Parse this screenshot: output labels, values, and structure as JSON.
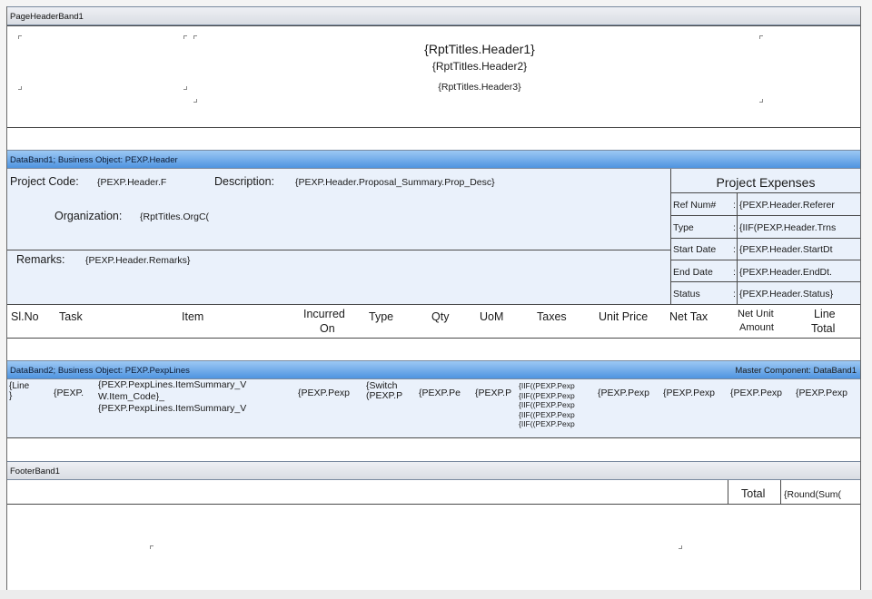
{
  "bands": {
    "page_header": "PageHeaderBand1",
    "data1": "DataBand1; Business Object: PEXP.Header",
    "data2": "DataBand2; Business Object: PEXP.PexpLines",
    "data2_master": "Master Component: DataBand1",
    "footer": "FooterBand1"
  },
  "header": {
    "title1": "{RptTitles.Header1}",
    "title2": "{RptTitles.Header2}",
    "title3": "{RptTitles.Header3}"
  },
  "data1": {
    "project_code_label": "Project Code:",
    "project_code_value": "{PEXP.Header.F",
    "description_label": "Description:",
    "description_value": "{PEXP.Header.Proposal_Summary.Prop_Desc}",
    "organization_label": "Organization:",
    "organization_value": "{RptTitles.OrgC(",
    "remarks_label": "Remarks:",
    "remarks_value": "{PEXP.Header.Remarks}",
    "panel_title": "Project Expenses",
    "panel_rows": [
      {
        "label": "Ref Num#",
        "colon": ":",
        "value": "{PEXP.Header.Referer"
      },
      {
        "label": "Type",
        "colon": ":",
        "value": "{IIF(PEXP.Header.Trns"
      },
      {
        "label": "Start Date",
        "colon": ":",
        "value": "{PEXP.Header.StartDt"
      },
      {
        "label": "End Date",
        "colon": ":",
        "value": "{PEXP.Header.EndDt."
      },
      {
        "label": "Status",
        "colon": ":",
        "value": "{PEXP.Header.Status}"
      }
    ]
  },
  "columns": {
    "slno": "Sl.No",
    "task": "Task",
    "item": "Item",
    "incurred_1": "Incurred",
    "incurred_2": "On",
    "type": "Type",
    "qty": "Qty",
    "uom": "UoM",
    "taxes": "Taxes",
    "unit_price": "Unit Price",
    "net_tax": "Net Tax",
    "net_unit_1": "Net Unit",
    "net_unit_2": "Amount",
    "line_1": "Line",
    "line_2": "Total"
  },
  "data2": {
    "c_line_1": "{Line",
    "c_line_2": "}",
    "c_task": "{PEXP.",
    "c_item_1": "{PEXP.PexpLines.ItemSummary_V",
    "c_item_2": "W.Item_Code}_",
    "c_item_3": "{PEXP.PexpLines.ItemSummary_V",
    "c_incurred": "{PEXP.Pexp",
    "c_type_1": "{Switch",
    "c_type_2": "(PEXP.P",
    "c_qty": "{PEXP.Pe",
    "c_uom": "{PEXP.P",
    "c_taxes": [
      "{IIF((PEXP.Pexp",
      "{IIF((PEXP.Pexp",
      "{IIF((PEXP.Pexp",
      "{IIF((PEXP.Pexp",
      "{IIF((PEXP.Pexp"
    ],
    "c_unit_price": "{PEXP.Pexp",
    "c_net_tax": "{PEXP.Pexp",
    "c_net_unit": "{PEXP.Pexp",
    "c_line_total": "{PEXP.Pexp"
  },
  "footer": {
    "total_label": "Total",
    "total_value": "{Round(Sum("
  }
}
